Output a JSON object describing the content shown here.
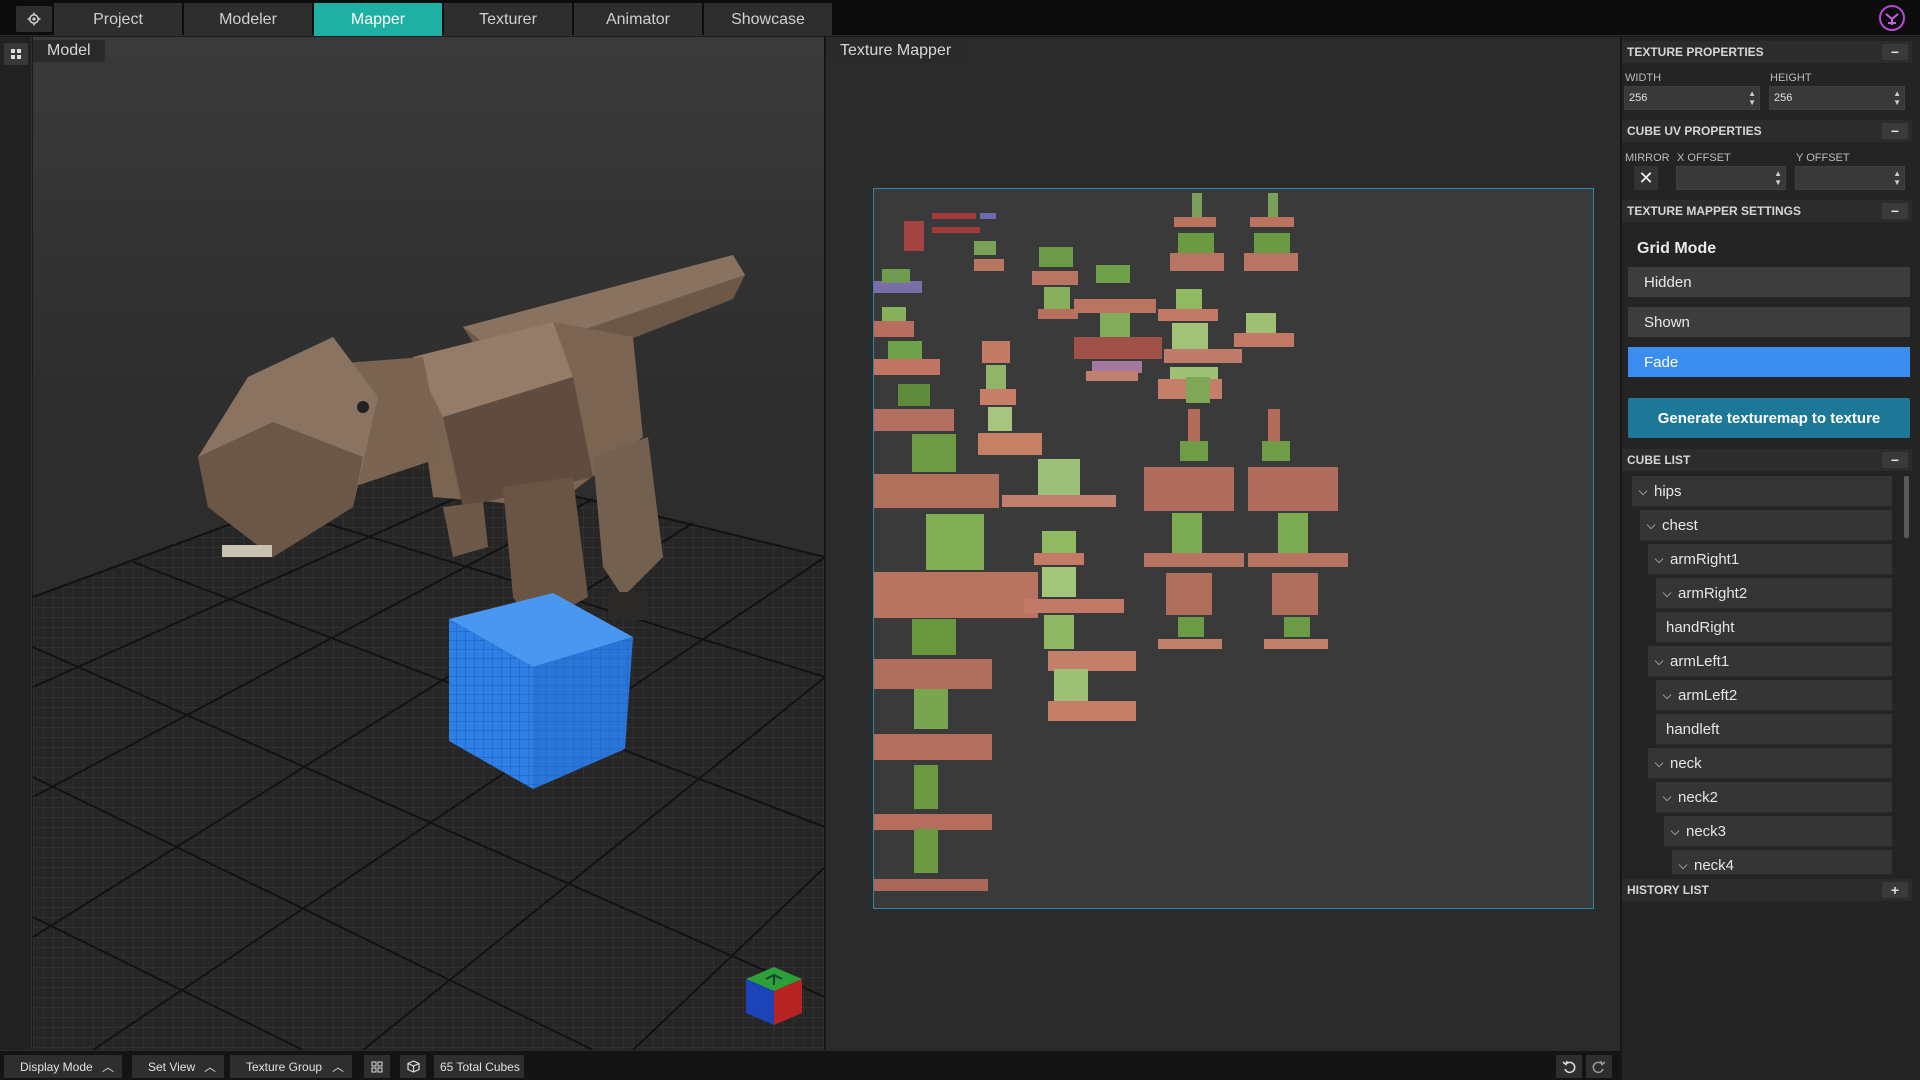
{
  "header": {
    "settings_icon": "gear-icon",
    "tabs": [
      {
        "label": "Project",
        "active": false
      },
      {
        "label": "Modeler",
        "active": false
      },
      {
        "label": "Mapper",
        "active": true
      },
      {
        "label": "Texturer",
        "active": false
      },
      {
        "label": "Animator",
        "active": false
      },
      {
        "label": "Showcase",
        "active": false
      }
    ],
    "logo_icon": "dumbcode-logo-icon"
  },
  "model_panel": {
    "title": "Model"
  },
  "mapper_panel": {
    "title": "Texture Mapper"
  },
  "sidebar": {
    "texture_properties": {
      "title": "TEXTURE PROPERTIES",
      "width_label": "WIDTH",
      "width_value": "256",
      "height_label": "HEIGHT",
      "height_value": "256"
    },
    "cube_uv_properties": {
      "title": "CUBE UV PROPERTIES",
      "mirror_label": "MIRROR",
      "mirror_checked_glyph": "✕",
      "x_offset_label": "X OFFSET",
      "x_offset_value": "",
      "y_offset_label": "Y OFFSET",
      "y_offset_value": ""
    },
    "texture_mapper_settings": {
      "title": "TEXTURE MAPPER SETTINGS",
      "grid_mode_title": "Grid Mode",
      "options": [
        "Hidden",
        "Shown",
        "Fade"
      ],
      "selected": "Fade",
      "generate_label": "Generate texturemap to texture"
    },
    "cube_list": {
      "title": "CUBE LIST",
      "items": [
        {
          "label": "hips",
          "depth": 0,
          "expanded": true
        },
        {
          "label": "chest",
          "depth": 1,
          "expanded": true
        },
        {
          "label": "armRight1",
          "depth": 2,
          "expanded": true
        },
        {
          "label": "armRight2",
          "depth": 3,
          "expanded": true
        },
        {
          "label": "handRight",
          "depth": 3,
          "expanded": null
        },
        {
          "label": "armLeft1",
          "depth": 2,
          "expanded": true
        },
        {
          "label": "armLeft2",
          "depth": 3,
          "expanded": true
        },
        {
          "label": "handleft",
          "depth": 3,
          "expanded": null
        },
        {
          "label": "neck",
          "depth": 2,
          "expanded": true
        },
        {
          "label": "neck2",
          "depth": 3,
          "expanded": true
        },
        {
          "label": "neck3",
          "depth": 4,
          "expanded": true
        },
        {
          "label": "neck4",
          "depth": 5,
          "expanded": true
        }
      ]
    },
    "history_list": {
      "title": "HISTORY LIST",
      "action_glyph": "+"
    }
  },
  "bottom_bar": {
    "display_mode": "Display Mode",
    "set_view": "Set View",
    "texture_group": "Texture Group",
    "grid_toggle_icon": "grid-icon",
    "cube_icon": "cube-icon",
    "total_cubes": "65 Total Cubes",
    "undo_icon": "undo-icon",
    "redo_icon": "redo-icon"
  },
  "colors": {
    "accent_tab": "#1fb0a4",
    "selected_option": "#3b8ef0",
    "generate_button": "#1d7897",
    "selected_cube": "#2f7fe0",
    "texture_frame": "#2f86b0"
  }
}
